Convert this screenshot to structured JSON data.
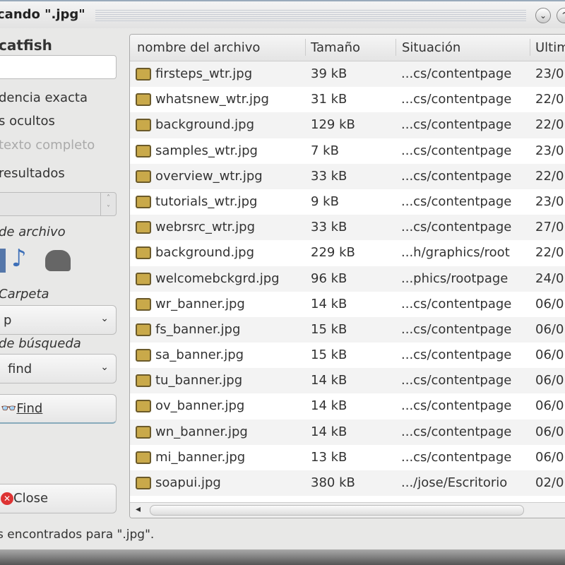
{
  "window": {
    "title": "cando \".jpg\"",
    "min_label": "⌄",
    "max_label": "⌃"
  },
  "sidebar": {
    "app_name": "catfish",
    "search_value": "",
    "options": [
      "dencia exacta",
      "s ocultos",
      "texto completo",
      "resultados"
    ],
    "filetype_label": "de archivo",
    "folder_label": "Carpeta",
    "folder_value": "p",
    "method_label": "de búsqueda",
    "method_value": "find",
    "find_label": "Find",
    "close_label": "Close"
  },
  "table": {
    "columns": [
      "nombre del archivo",
      "Tamaño",
      "Situación",
      "Ultim"
    ],
    "rows": [
      {
        "name": "firsteps_wtr.jpg",
        "size": "39 kB",
        "path": "...cs/contentpage",
        "date": "23/0"
      },
      {
        "name": "whatsnew_wtr.jpg",
        "size": "31 kB",
        "path": "...cs/contentpage",
        "date": "22/0"
      },
      {
        "name": "background.jpg",
        "size": "129 kB",
        "path": "...cs/contentpage",
        "date": "22/0"
      },
      {
        "name": "samples_wtr.jpg",
        "size": "7 kB",
        "path": "...cs/contentpage",
        "date": "23/0"
      },
      {
        "name": "overview_wtr.jpg",
        "size": "33 kB",
        "path": "...cs/contentpage",
        "date": "22/0"
      },
      {
        "name": "tutorials_wtr.jpg",
        "size": "9 kB",
        "path": "...cs/contentpage",
        "date": "23/0"
      },
      {
        "name": "webrsrc_wtr.jpg",
        "size": "33 kB",
        "path": "...cs/contentpage",
        "date": "27/0"
      },
      {
        "name": "background.jpg",
        "size": "229 kB",
        "path": "...h/graphics/root",
        "date": "22/0"
      },
      {
        "name": "welcomebckgrd.jpg",
        "size": "96 kB",
        "path": "...phics/rootpage",
        "date": "24/0"
      },
      {
        "name": "wr_banner.jpg",
        "size": "14 kB",
        "path": "...cs/contentpage",
        "date": "06/0"
      },
      {
        "name": "fs_banner.jpg",
        "size": "15 kB",
        "path": "...cs/contentpage",
        "date": "06/0"
      },
      {
        "name": "sa_banner.jpg",
        "size": "15 kB",
        "path": "...cs/contentpage",
        "date": "06/0"
      },
      {
        "name": "tu_banner.jpg",
        "size": "14 kB",
        "path": "...cs/contentpage",
        "date": "06/0"
      },
      {
        "name": "ov_banner.jpg",
        "size": "14 kB",
        "path": "...cs/contentpage",
        "date": "06/0"
      },
      {
        "name": "wn_banner.jpg",
        "size": "14 kB",
        "path": "...cs/contentpage",
        "date": "06/0"
      },
      {
        "name": "mi_banner.jpg",
        "size": "13 kB",
        "path": "...cs/contentpage",
        "date": "06/0"
      },
      {
        "name": "soapui.jpg",
        "size": "380 kB",
        "path": ".../jose/Escritorio",
        "date": "02/0"
      }
    ]
  },
  "status": "s encontrados para \".jpg\"."
}
